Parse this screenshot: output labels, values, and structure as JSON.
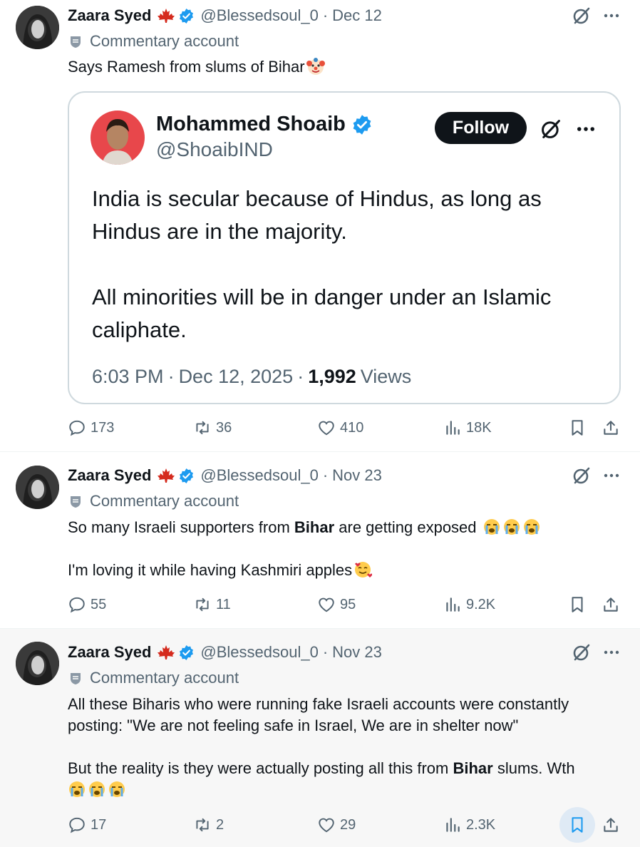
{
  "tweets": [
    {
      "author": {
        "name": "Zaara Syed",
        "handle": "@Blessedsoul_0",
        "date": "Dec 12",
        "badge": "Commentary account"
      },
      "text": "Says Ramesh from slums of Bihar",
      "quote": {
        "name": "Mohammed Shoaib",
        "handle": "@ShoaibIND",
        "follow_label": "Follow",
        "text": "India is secular because of Hindus, as long as Hindus are in the majority.\n\nAll minorities will be in danger under an Islamic caliphate.",
        "time": "6:03 PM",
        "date": "Dec 12, 2025",
        "views_count": "1,992",
        "views_label": "Views"
      },
      "stats": {
        "replies": "173",
        "reposts": "36",
        "likes": "410",
        "views": "18K"
      }
    },
    {
      "author": {
        "name": "Zaara Syed",
        "handle": "@Blessedsoul_0",
        "date": "Nov 23",
        "badge": "Commentary account"
      },
      "text_line1_pre": "So many Israeli supporters from ",
      "text_line1_bold": "Bihar",
      "text_line1_post": " are getting exposed",
      "text_line2": "I'm loving it while having Kashmiri apples",
      "stats": {
        "replies": "55",
        "reposts": "11",
        "likes": "95",
        "views": "9.2K"
      }
    },
    {
      "author": {
        "name": "Zaara Syed",
        "handle": "@Blessedsoul_0",
        "date": "Nov 23",
        "badge": "Commentary account"
      },
      "text_p1": "All these Biharis who were running fake Israeli accounts were constantly posting: \"We are not feeling safe in Israel, We are in shelter now\"",
      "text_p2_pre": "But the reality is they were actually posting all this from ",
      "text_p2_bold": "Bihar",
      "text_p2_post": " slums. Wth",
      "stats": {
        "replies": "17",
        "reposts": "2",
        "likes": "29",
        "views": "2.3K"
      }
    }
  ],
  "colors": {
    "verified": "#1d9bf0",
    "muted": "#536471",
    "flag": "#d52b1e",
    "bookmark_highlight": "#dfeaf5"
  },
  "icons": [
    "grok-icon",
    "more-icon",
    "reply-icon",
    "repost-icon",
    "like-icon",
    "views-icon",
    "bookmark-icon",
    "share-icon",
    "verified-icon",
    "canada-flag-icon",
    "commentary-badge-icon",
    "clown-emoji",
    "crying-emoji",
    "smiling-hearts-emoji"
  ]
}
